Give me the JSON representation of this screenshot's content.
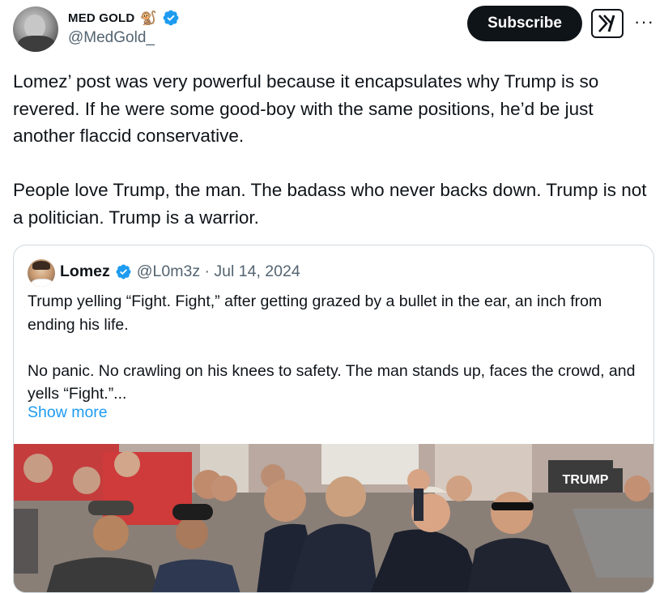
{
  "author": {
    "display_name": "MED GOLD",
    "emoji": "🐒",
    "handle": "@MedGold_"
  },
  "actions": {
    "subscribe_label": "Subscribe",
    "grok_icon": "grok-icon",
    "more_icon": "more-icon"
  },
  "post": {
    "text": "Lomez’ post was very powerful because it encapsulates why Trump is so revered. If he were some good-boy with the same positions, he’d be just another flaccid conservative.\n\nPeople love Trump, the man. The badass who never backs down. Trump is not a politician. Trump is a warrior."
  },
  "quote": {
    "display_name": "Lomez",
    "handle_date": "@L0m3z · Jul 14, 2024",
    "text": "Trump yelling “Fight. Fight,” after getting grazed by a bullet in the ear, an inch from ending his life.\n\nNo panic. No crawling on his knees to safety. The man stands up, faces the crowd, and yells “Fight.”...",
    "show_more": "Show more",
    "media_sign_text": "TRUMP"
  },
  "colors": {
    "verified_blue": "#1d9bf0",
    "text_primary": "#0f1419",
    "text_secondary": "#536471",
    "border": "#cfd9de"
  }
}
